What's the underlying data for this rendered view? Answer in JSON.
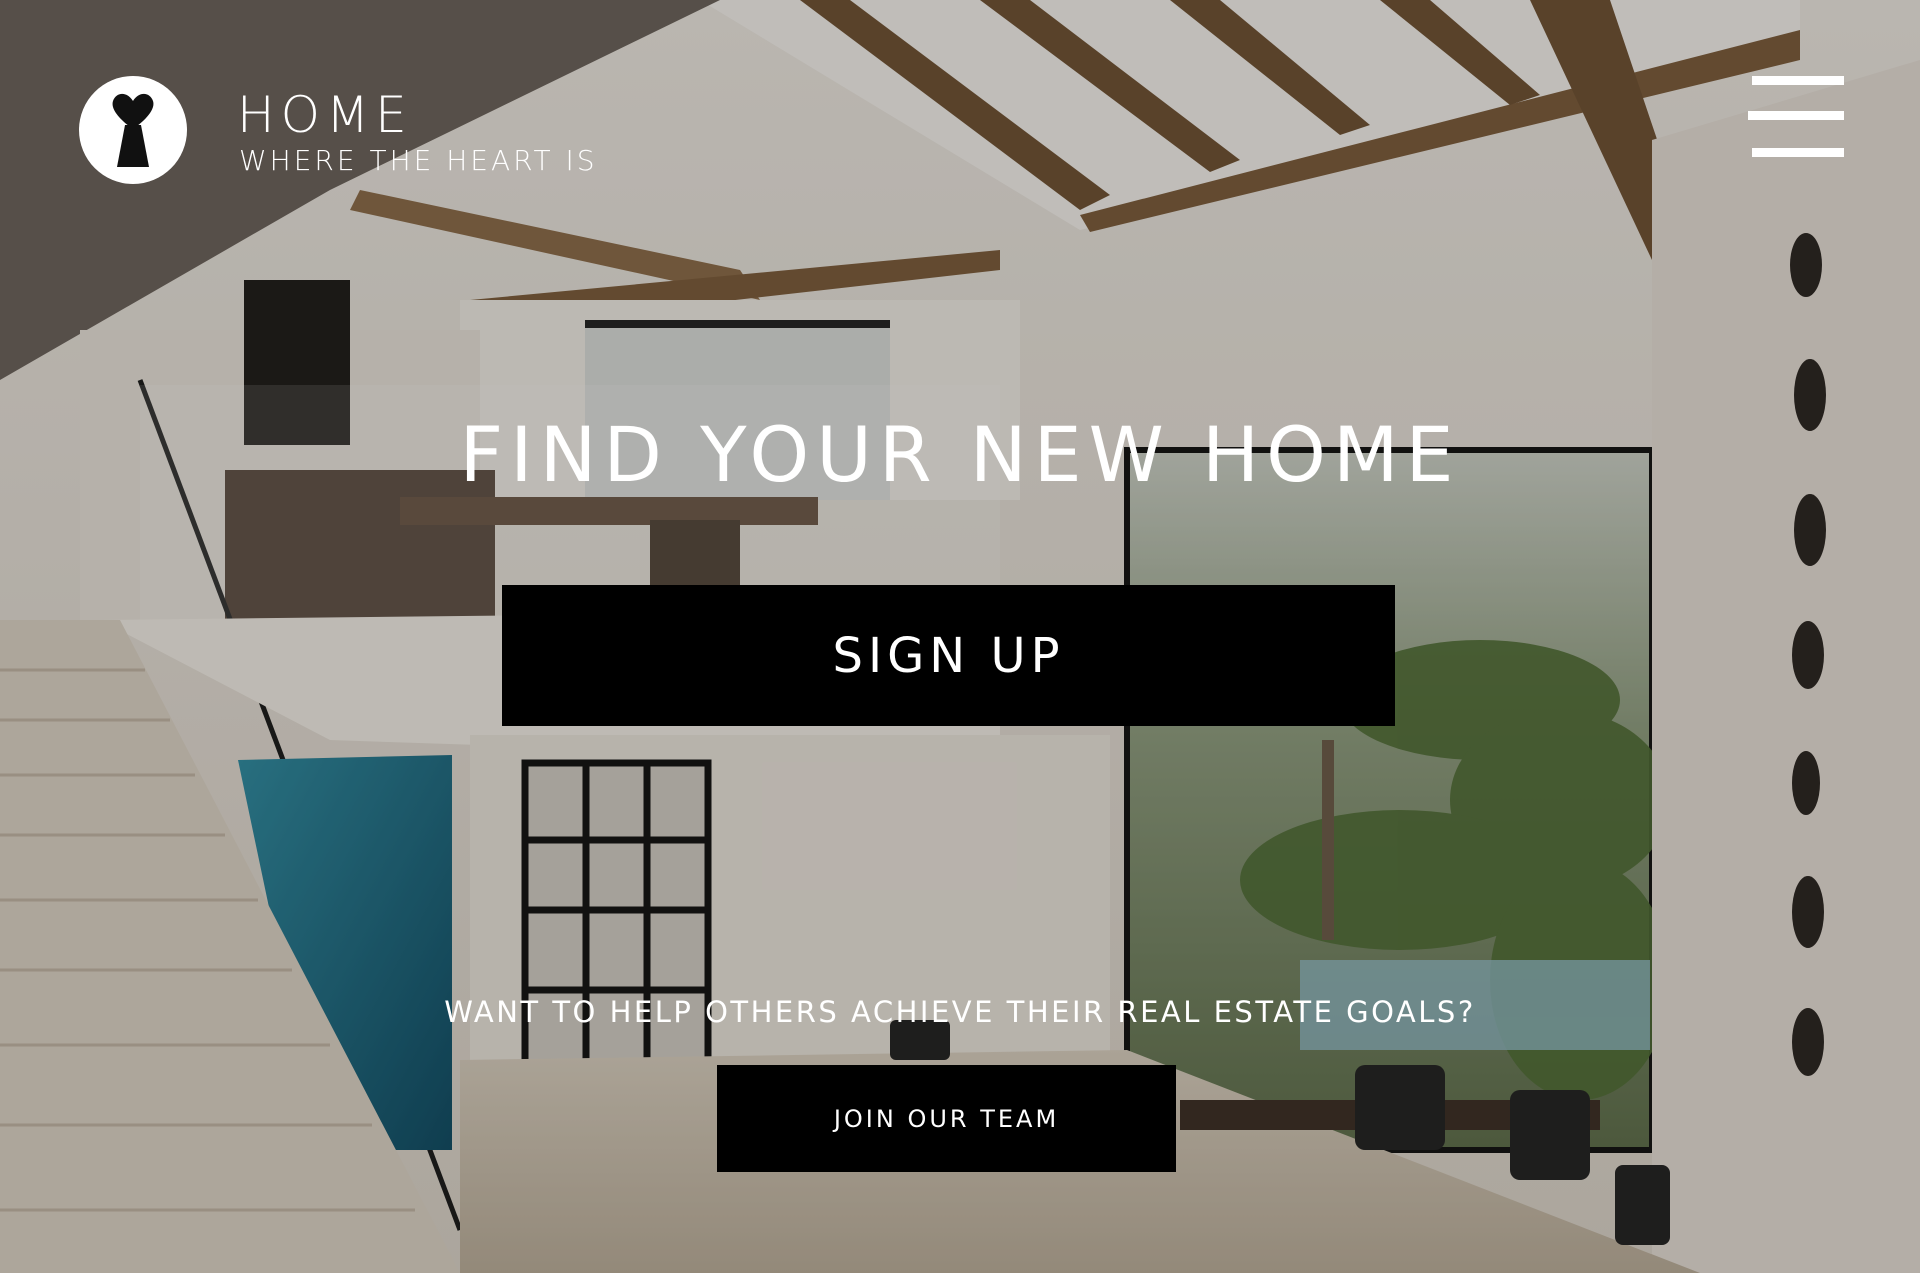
{
  "brand": {
    "name": "HOME",
    "tagline": "WHERE THE HEART IS",
    "logo_icon": "keyhole-heart-icon"
  },
  "nav": {
    "menu_icon": "hamburger-menu-icon"
  },
  "hero": {
    "headline": "FIND YOUR NEW HOME",
    "signup_label": "SIGN UP",
    "team_prompt": "WANT TO HELP OTHERS ACHIEVE THEIR REAL ESTATE GOALS?",
    "join_label": "JOIN OUR TEAM"
  },
  "colors": {
    "button_bg": "#000000",
    "text": "#ffffff",
    "logo_bg": "#ffffff"
  }
}
